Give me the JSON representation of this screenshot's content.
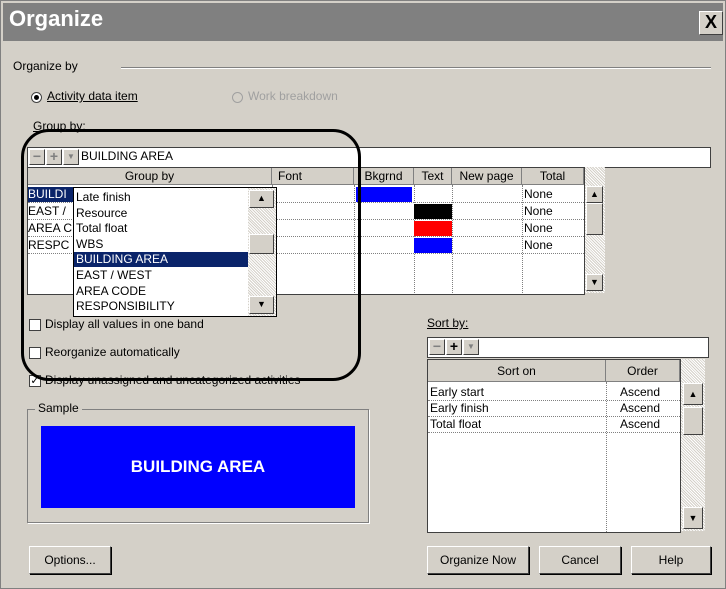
{
  "dialog": {
    "title": "Organize",
    "close": "X"
  },
  "organize_by": {
    "label": "Organize by",
    "option_activity": "Activity data item",
    "option_wbs": "Work breakdown"
  },
  "group_by": {
    "label": "Group by:",
    "current_value": "BUILDING AREA",
    "headers": {
      "group_by": "Group by",
      "font": "Font",
      "bkgrnd": "Bkgrnd",
      "text": "Text",
      "new_page": "New page",
      "total": "Total"
    },
    "rows": [
      {
        "group": "BUILDI",
        "bkgrnd": "#0000ff",
        "text_color": "",
        "total": "None"
      },
      {
        "group": "EAST /",
        "bkgrnd": "",
        "text_color": "#000000",
        "total": "None"
      },
      {
        "group": "AREA C",
        "bkgrnd": "",
        "text_color": "#ff0000",
        "total": "None"
      },
      {
        "group": "RESPC",
        "bkgrnd": "",
        "text_color": "#0000ff",
        "total": "None"
      }
    ],
    "dropdown_items": [
      "Late finish",
      "Resource",
      "Total float",
      "WBS",
      "BUILDING AREA",
      "EAST / WEST",
      "AREA CODE",
      "RESPONSIBILITY"
    ],
    "dropdown_selected_index": 4
  },
  "options": {
    "display_all_values": "Display all values in one band",
    "reorganize_auto": "Reorganize automatically",
    "display_unassigned": "Display unassigned and uncategorized activities"
  },
  "sample": {
    "label": "Sample",
    "text": "BUILDING AREA",
    "bg_color": "#0000ff"
  },
  "sort_by": {
    "label": "Sort by:",
    "headers": {
      "sort_on": "Sort on",
      "order": "Order"
    },
    "rows": [
      {
        "sort_on": "Early start",
        "order": "Ascend"
      },
      {
        "sort_on": "Early finish",
        "order": "Ascend"
      },
      {
        "sort_on": "Total float",
        "order": "Ascend"
      }
    ]
  },
  "buttons": {
    "options": "Options...",
    "organize_now": "Organize Now",
    "cancel": "Cancel",
    "help": "Help"
  }
}
